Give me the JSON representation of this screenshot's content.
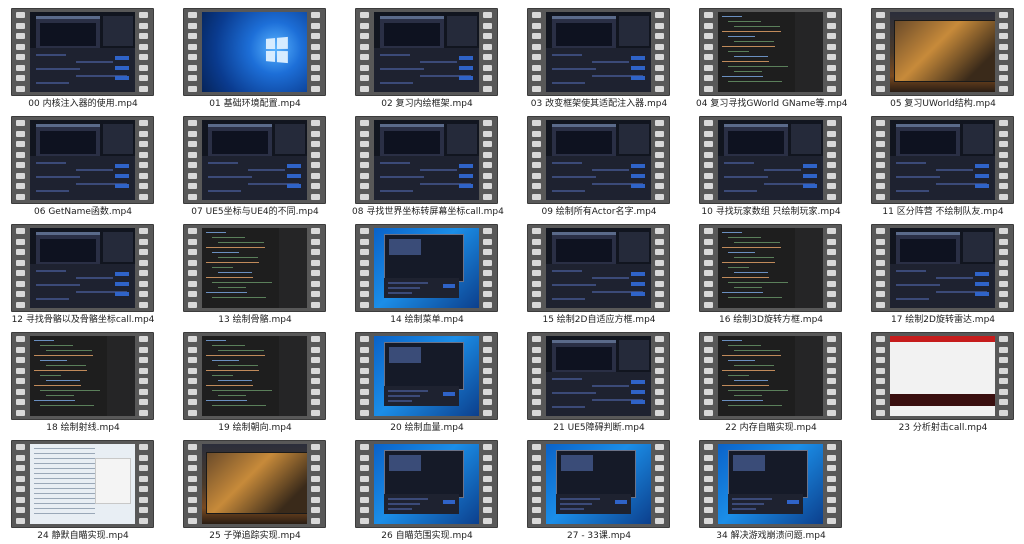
{
  "files": [
    {
      "name": "00 内核注入器的使用.mp4",
      "thumb": "dark"
    },
    {
      "name": "01 基础环境配置.mp4",
      "thumb": "win10"
    },
    {
      "name": "02 复习内绘框架.mp4",
      "thumb": "dark"
    },
    {
      "name": "03 改变框架使其适配注入器.mp4",
      "thumb": "dark"
    },
    {
      "name": "04 复习寻找GWorld GName等.mp4",
      "thumb": "code"
    },
    {
      "name": "05 复习UWorld结构.mp4",
      "thumb": "game"
    },
    {
      "name": "06 GetName函数.mp4",
      "thumb": "dark"
    },
    {
      "name": "07 UE5坐标与UE4的不同.mp4",
      "thumb": "dark"
    },
    {
      "name": "08 寻找世界坐标转屏幕坐标call.mp4",
      "thumb": "dark"
    },
    {
      "name": "09 绘制所有Actor名字.mp4",
      "thumb": "dark"
    },
    {
      "name": "10 寻找玩家数组 只绘制玩家.mp4",
      "thumb": "dark"
    },
    {
      "name": "11 区分阵营 不绘制队友.mp4",
      "thumb": "dark"
    },
    {
      "name": "12 寻找骨骼以及骨骼坐标call.mp4",
      "thumb": "dark"
    },
    {
      "name": "13 绘制骨骼.mp4",
      "thumb": "code"
    },
    {
      "name": "14 绘制菜单.mp4",
      "thumb": "blue"
    },
    {
      "name": "15 绘制2D自适应方框.mp4",
      "thumb": "dark"
    },
    {
      "name": "16 绘制3D旋转方框.mp4",
      "thumb": "code"
    },
    {
      "name": "17 绘制2D旋转雷达.mp4",
      "thumb": "dark"
    },
    {
      "name": "18 绘制射线.mp4",
      "thumb": "code"
    },
    {
      "name": "19 绘制朝向.mp4",
      "thumb": "code"
    },
    {
      "name": "20 绘制血量.mp4",
      "thumb": "blue"
    },
    {
      "name": "21 UE5障碍判断.mp4",
      "thumb": "dark"
    },
    {
      "name": "22 内存自瞄实现.mp4",
      "thumb": "code"
    },
    {
      "name": "23 分析射击call.mp4",
      "thumb": "white"
    },
    {
      "name": "24 静默自瞄实现.mp4",
      "thumb": "list"
    },
    {
      "name": "25 子弹追踪实现.mp4",
      "thumb": "game"
    },
    {
      "name": "26 自瞄范围实现.mp4",
      "thumb": "blue"
    },
    {
      "name": "27 - 33课.mp4",
      "thumb": "blue"
    },
    {
      "name": "34 解决游戏崩溃问题.mp4",
      "thumb": "blue"
    }
  ]
}
